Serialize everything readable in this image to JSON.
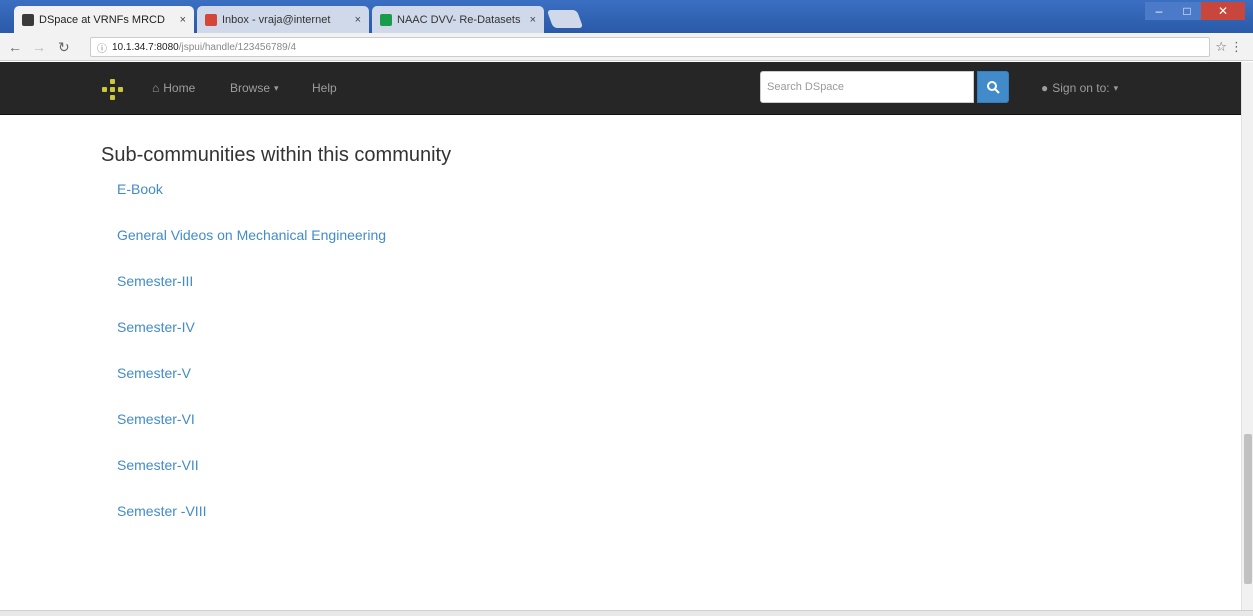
{
  "browser": {
    "tabs": [
      {
        "title": "DSpace at VRNFs MRCD",
        "favicon_color": "#3a3a3a",
        "active": true
      },
      {
        "title": "Inbox - vraja@internet",
        "favicon_color": "#d44638",
        "active": false
      },
      {
        "title": "NAAC DVV- Re-Datasets",
        "favicon_color": "#1a9c4a",
        "active": false
      }
    ],
    "close_glyph": "×",
    "url": {
      "host": "10.1.34.7:8080",
      "path": "/jspui/handle/123456789/4"
    },
    "icons": {
      "back": "arrow-left-icon",
      "forward": "arrow-right-icon",
      "reload": "reload-icon",
      "info": "info-icon",
      "bookmark": "star-icon",
      "menu": "kebab-menu-icon"
    }
  },
  "navbar": {
    "home_label": "Home",
    "browse_label": "Browse",
    "help_label": "Help",
    "search_placeholder": "Search DSpace",
    "signin_label": "Sign on to:",
    "colors": {
      "background": "#262626",
      "text": "#9d9d9d",
      "search_button": "#428bca"
    }
  },
  "main": {
    "heading": "Sub-communities within this community",
    "sub_communities": [
      "E-Book",
      "General Videos on Mechanical Engineering",
      "Semester-III",
      "Semester-IV",
      "Semester-V",
      "Semester-VI",
      "Semester-VII",
      "Semester -VIII"
    ],
    "link_color": "#428bca"
  }
}
